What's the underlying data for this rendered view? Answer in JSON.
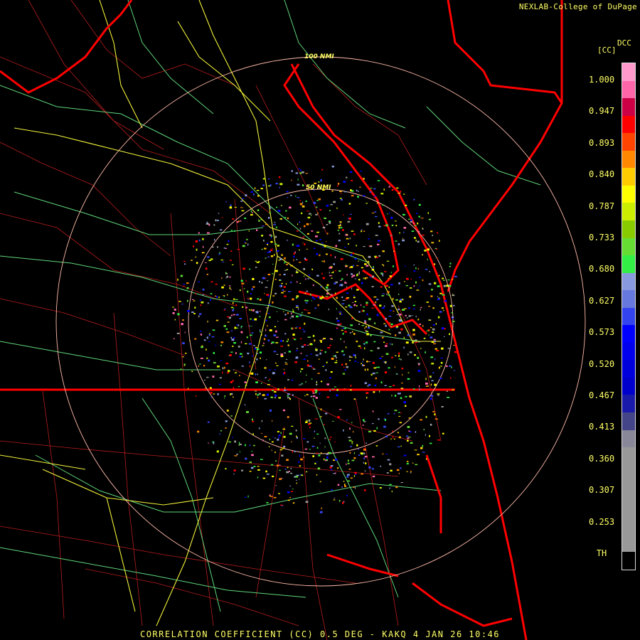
{
  "header": {
    "credit": "NEXLAB-College of DuPage"
  },
  "footer": {
    "product_text": "CORRELATION COEFFICIENT (CC) 0.5 DEG - KAKQ 4 JAN 26 10:46"
  },
  "range_rings": [
    {
      "label": "50 NMI"
    },
    {
      "label": "100 NMI"
    }
  ],
  "colorbar": {
    "title_left": "[CC]",
    "title_right": "DCC",
    "tick_labels": [
      "1.000",
      "0.947",
      "0.893",
      "0.840",
      "0.787",
      "0.733",
      "0.680",
      "0.627",
      "0.573",
      "0.520",
      "0.467",
      "0.413",
      "0.360",
      "0.307",
      "0.253",
      "TH"
    ],
    "segments": [
      "#ff99cc",
      "#ff66aa",
      "#cc0044",
      "#ff0000",
      "#ff4400",
      "#ff8800",
      "#ffcc00",
      "#ffff00",
      "#ccee00",
      "#88cc00",
      "#66dd33",
      "#33ee44",
      "#8899dd",
      "#6677dd",
      "#3344ee",
      "#0000ff",
      "#0000ee",
      "#0000dd",
      "#0000cc",
      "#1a1aaa",
      "#444488",
      "#888899",
      "#999999",
      "#999999",
      "#999999",
      "#999999",
      "#999999",
      "#999999",
      "#000000"
    ]
  },
  "colors": {
    "state_border": "#ff0000",
    "county_border": "#cc2020",
    "roads": "#ffff44",
    "highways": "#66ee88",
    "ring": "#ffbbaa",
    "text": "#ffff66"
  }
}
